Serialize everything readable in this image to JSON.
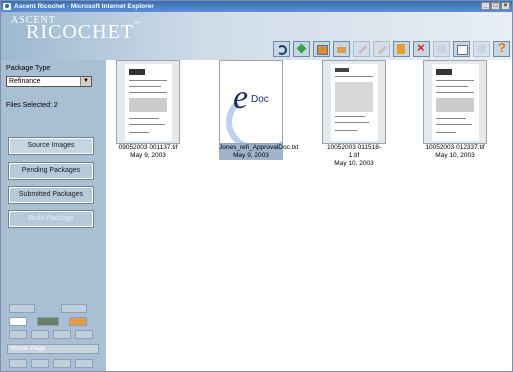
{
  "window": {
    "title": "Ascent Ricochet - Microsoft Internet Explorer",
    "controls": [
      "_",
      "□",
      "×"
    ]
  },
  "logo": {
    "line1": "ASCENT",
    "line2": "RICOCHET",
    "tm": "™"
  },
  "toolbar": {
    "icons": [
      "refresh-icon",
      "forward-icon",
      "organize-icon",
      "folder-icon",
      "erase-icon",
      "send-icon",
      "notes-icon",
      "delete-icon",
      "print-icon",
      "checklist-icon",
      "edit-icon",
      "help-icon"
    ]
  },
  "sidebar": {
    "package_type_label": "Package Type",
    "package_type_value": "Refinance",
    "files_selected": "Files Selected: 2",
    "nav": {
      "source": "Source Images",
      "pending": "Pending Packages",
      "submitted": "Submitted Packages",
      "build": "Build Package"
    },
    "zoom_value": "Whole Page"
  },
  "thumbnails": [
    {
      "name": "09052003 001137.tif",
      "date": "May 9, 2003",
      "selected": false
    },
    {
      "name": "Jones_refi_ApprovalDoc.txt",
      "date": "May 9, 2003",
      "selected": true
    },
    {
      "name": "10052003 011518-1.tif",
      "date": "May 10, 2003",
      "selected": false
    },
    {
      "name": "10052003 012337.tif",
      "date": "May 10, 2003",
      "selected": false
    }
  ],
  "edoc_label": {
    "e": "e",
    "doc": "Doc"
  }
}
